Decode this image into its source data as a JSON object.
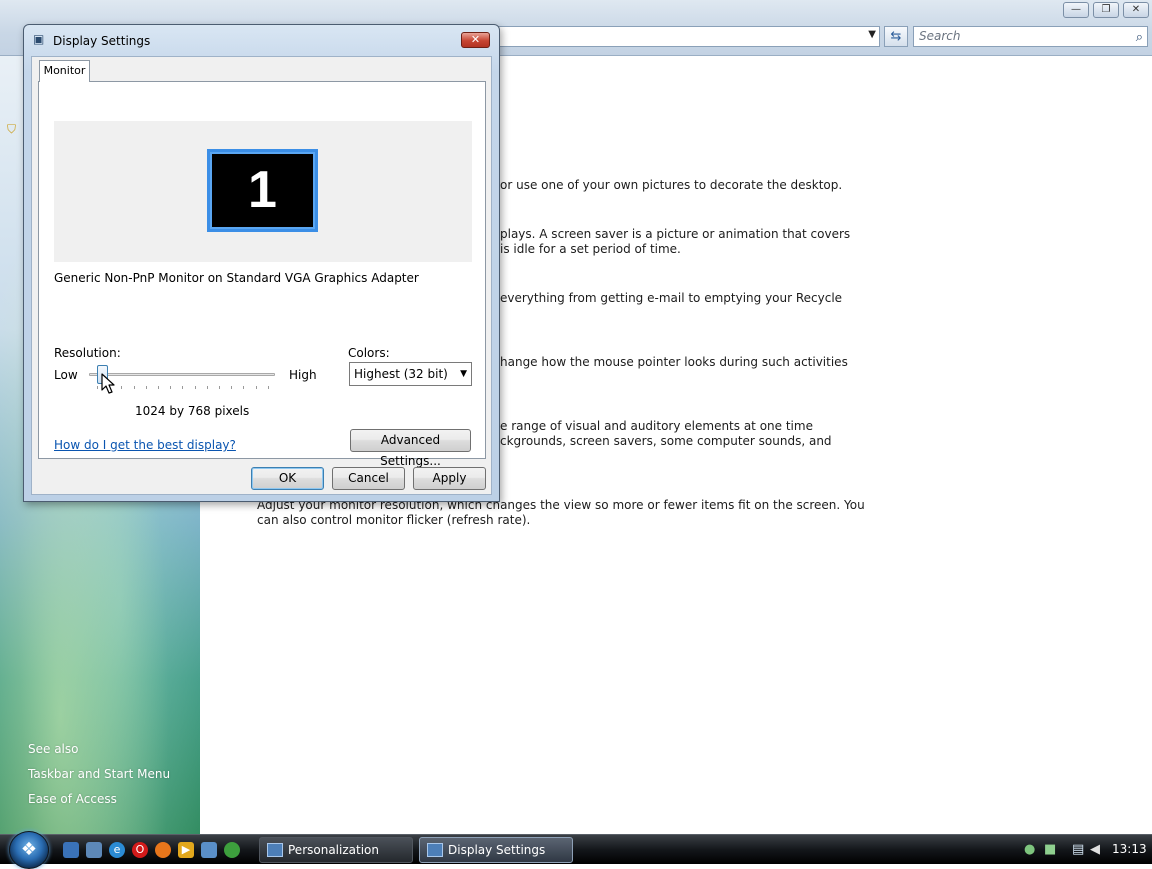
{
  "background_window": {
    "caption_buttons": {
      "minimize": "—",
      "maximize": "❐",
      "close": "✕"
    },
    "address_dropdown_arrow": "▼",
    "refresh_icon": "⇆",
    "search_placeholder": "Search",
    "search_icon": "⌕",
    "sidebar": {
      "see_also": "See also",
      "links": [
        "Taskbar and Start Menu",
        "Ease of Access"
      ]
    },
    "content_lines": [
      "or use one of your own pictures to decorate the desktop.",
      "plays. A screen saver is a picture or animation that covers",
      "is idle for a set period of time.",
      "everything from getting e-mail to emptying your Recycle",
      "hange how the mouse pointer looks during such activities",
      "e range of visual and auditory elements at one time",
      "ckgrounds, screen savers, some computer sounds, and",
      "Adjust your monitor resolution, which changes the view so more or fewer items fit on the screen. You",
      "can also control monitor flicker (refresh rate)."
    ]
  },
  "dialog": {
    "title": "Display Settings",
    "close_glyph": "✕",
    "tab_label": "Monitor",
    "monitor_number": "1",
    "monitor_name": "Generic Non-PnP Monitor on Standard VGA Graphics Adapter",
    "resolution_label": "Resolution:",
    "slider_low": "Low",
    "slider_high": "High",
    "resolution_value": "1024 by 768 pixels",
    "colors_label": "Colors:",
    "colors_selected": "Highest (32 bit)",
    "colors_arrow": "▼",
    "advanced_button": "Advanced Settings...",
    "help_link": "How do I get the best display?",
    "ok_button": "OK",
    "cancel_button": "Cancel",
    "apply_button": "Apply"
  },
  "taskbar": {
    "start_glyph": "❖",
    "quick_launch": [
      "desktop",
      "explorer",
      "ie",
      "opera",
      "firefox",
      "media-player",
      "windows-explorer",
      "chrome"
    ],
    "tasks": [
      "Personalization",
      "Display Settings"
    ],
    "clock": "13:13"
  }
}
